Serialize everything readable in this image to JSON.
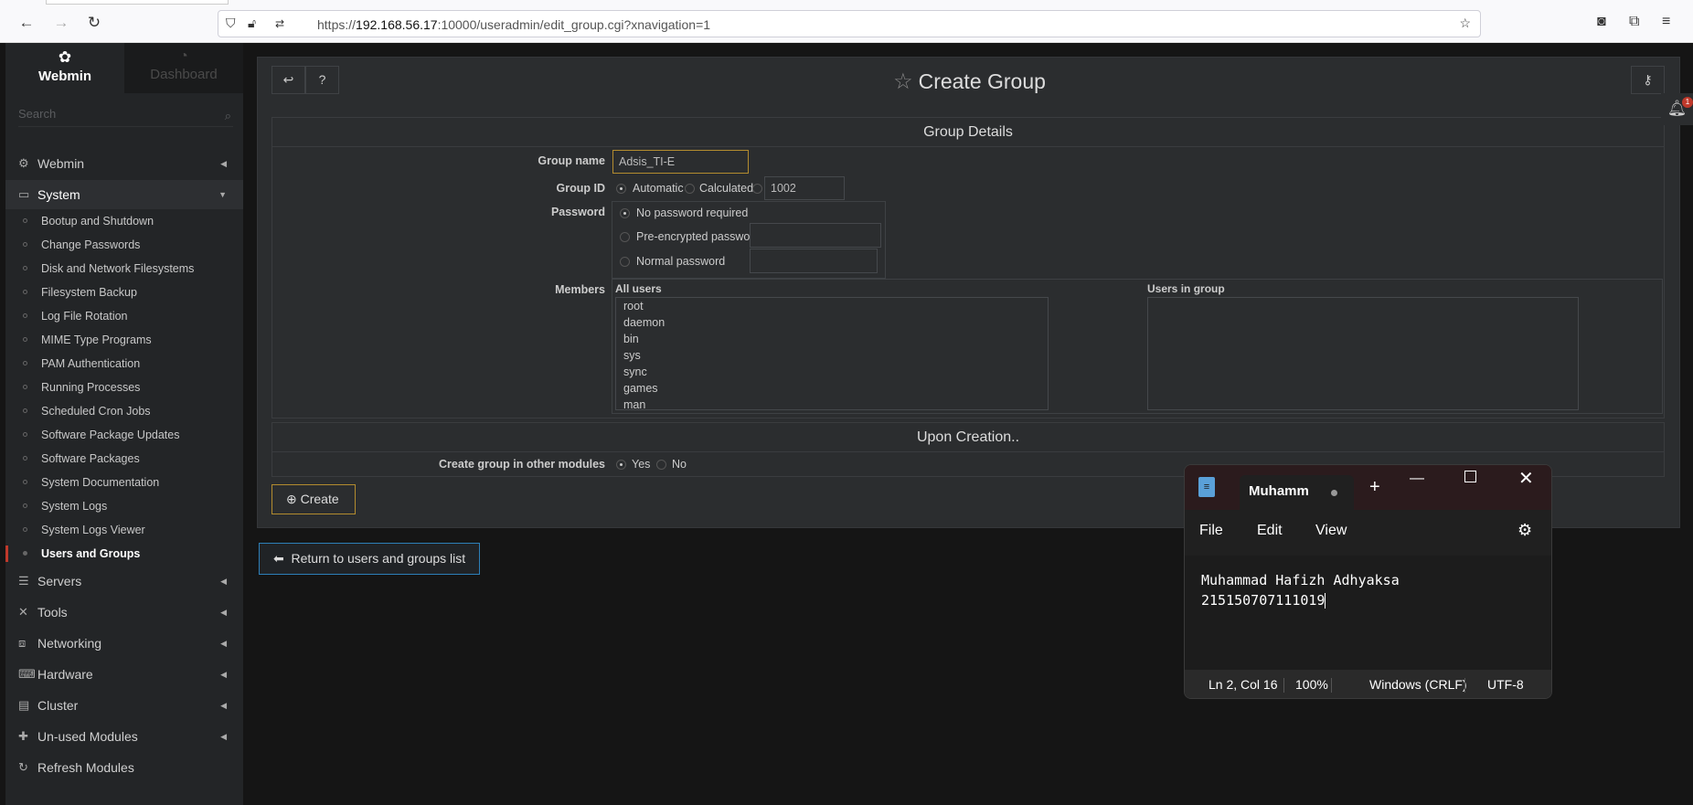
{
  "browser": {
    "url_prefix": "https://",
    "url_host": "192.168.56.17",
    "url_rest": ":10000/useradmin/edit_group.cgi?xnavigation=1"
  },
  "sidebar": {
    "brand": "Webmin",
    "dashboard": "Dashboard",
    "search_placeholder": "Search",
    "categories": {
      "webmin": "Webmin",
      "system": "System",
      "servers": "Servers",
      "tools": "Tools",
      "networking": "Networking",
      "hardware": "Hardware",
      "cluster": "Cluster",
      "unused": "Un-used Modules",
      "refresh": "Refresh Modules"
    },
    "system_items": [
      "Bootup and Shutdown",
      "Change Passwords",
      "Disk and Network Filesystems",
      "Filesystem Backup",
      "Log File Rotation",
      "MIME Type Programs",
      "PAM Authentication",
      "Running Processes",
      "Scheduled Cron Jobs",
      "Software Package Updates",
      "Software Packages",
      "System Documentation",
      "System Logs",
      "System Logs Viewer",
      "Users and Groups"
    ]
  },
  "page": {
    "title": "Create Group",
    "section_details": "Group Details",
    "group_name_label": "Group name",
    "group_name_value": "Adsis_TI-E",
    "group_id_label": "Group ID",
    "gid_automatic": "Automatic",
    "gid_calculated": "Calculated",
    "gid_value": "1002",
    "password_label": "Password",
    "pw_none": "No password required",
    "pw_preenc": "Pre-encrypted password",
    "pw_normal": "Normal password",
    "members_label": "Members",
    "all_users_label": "All users",
    "users_in_group_label": "Users in group",
    "all_users": [
      "root",
      "daemon",
      "bin",
      "sys",
      "sync",
      "games",
      "man"
    ],
    "section_creation": "Upon Creation..",
    "other_modules_label": "Create group in other modules",
    "yes": "Yes",
    "no": "No",
    "create_button": "Create",
    "return_button": "Return to users and groups list",
    "notification_count": "1"
  },
  "notepad": {
    "tab_title": "Muhamm",
    "menu": {
      "file": "File",
      "edit": "Edit",
      "view": "View"
    },
    "line1": "Muhammad Hafizh Adhyaksa",
    "line2": "215150707111019",
    "status": {
      "position": "Ln 2, Col 16",
      "zoom": "100%",
      "line_ending": "Windows (CRLF)",
      "encoding": "UTF-8"
    }
  }
}
